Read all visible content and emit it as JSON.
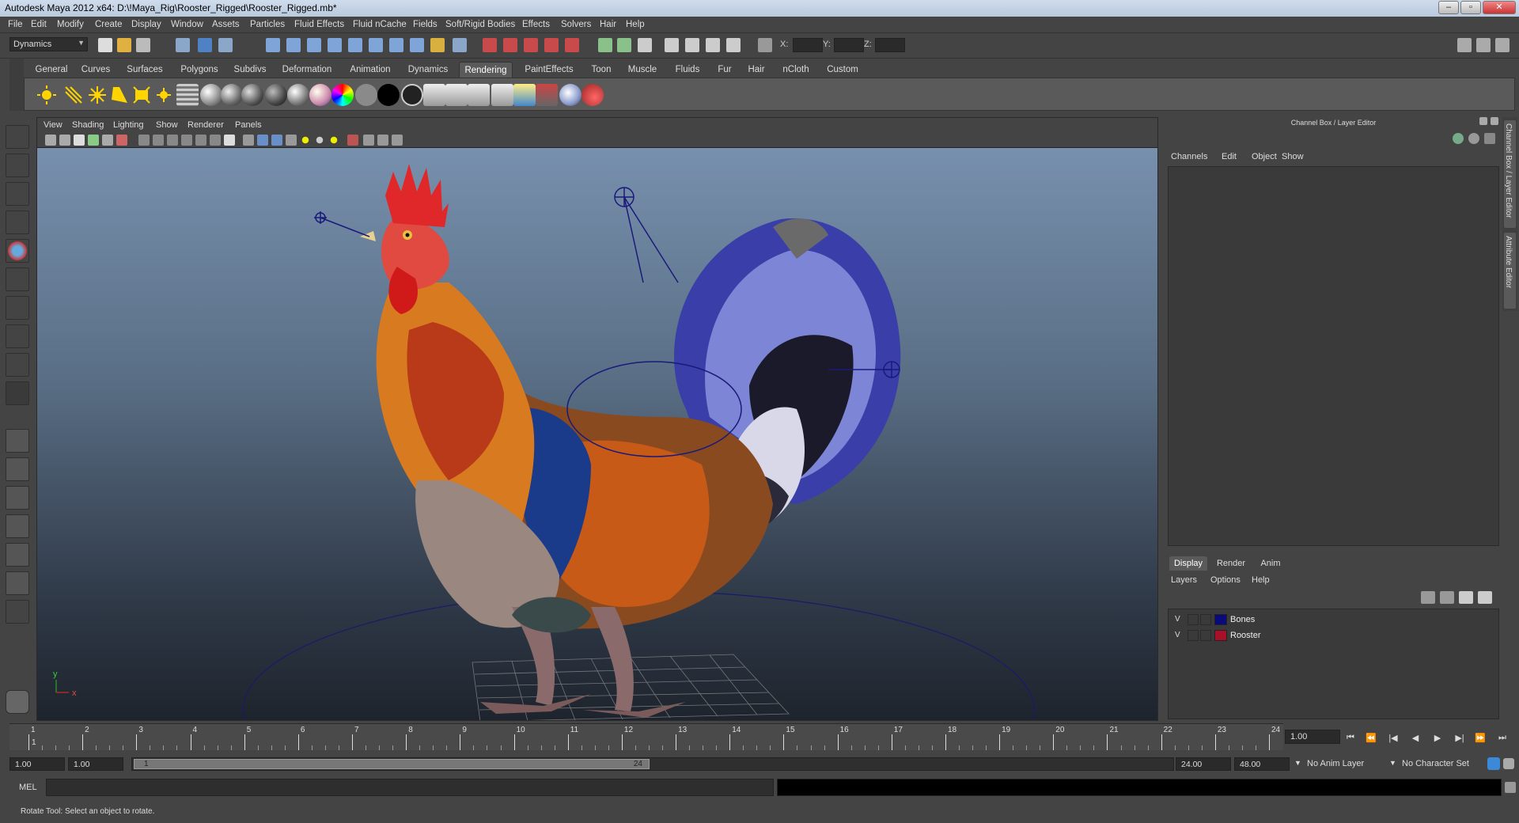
{
  "window": {
    "title": "Autodesk Maya 2012 x64: D:\\!Maya_Rig\\Rooster_Rigged\\Rooster_Rigged.mb*"
  },
  "menubar": [
    "File",
    "Edit",
    "Modify",
    "Create",
    "Display",
    "Window",
    "Assets",
    "Particles",
    "Fluid Effects",
    "Fluid nCache",
    "Fields",
    "Soft/Rigid Bodies",
    "Effects",
    "Solvers",
    "Hair",
    "Help"
  ],
  "status_line": {
    "mode": "Dynamics",
    "coord_labels": {
      "x": "X:",
      "y": "Y:",
      "z": "Z:"
    }
  },
  "shelf_tabs": [
    "General",
    "Curves",
    "Surfaces",
    "Polygons",
    "Subdivs",
    "Deformation",
    "Animation",
    "Dynamics",
    "Rendering",
    "PaintEffects",
    "Toon",
    "Muscle",
    "Fluids",
    "Fur",
    "Hair",
    "nCloth",
    "Custom"
  ],
  "active_shelf": "Rendering",
  "shelf_icons": [
    "ambient-light-icon",
    "directional-light-icon",
    "point-light-icon",
    "spot-light-icon",
    "area-light-icon",
    "volume-light-icon",
    "hypershade-icon",
    "lambert-sphere-icon",
    "blinn-sphere-icon",
    "phong-sphere-icon",
    "phonge-sphere-icon",
    "anisotropic-sphere-icon",
    "ramp-shader-icon",
    "layered-shader-icon",
    "use-background-icon",
    "black-shader-icon",
    "surface-shader-icon",
    "render-view-icon",
    "render-current-icon",
    "ipr-render-icon",
    "render-settings-icon",
    "batch-render-icon",
    "render-layer-icon",
    "mental-ray-icon",
    "paint-fx-icon"
  ],
  "viewport": {
    "menu": [
      "View",
      "Shading",
      "Lighting",
      "Show",
      "Renderer",
      "Panels"
    ],
    "axis": {
      "y": "y",
      "x": "x"
    }
  },
  "channel_box": {
    "title": "Channel Box / Layer Editor",
    "menu": [
      "Channels",
      "Edit",
      "Object",
      "Show"
    ]
  },
  "layer_editor": {
    "tabs": [
      "Display",
      "Render",
      "Anim"
    ],
    "active_tab": "Display",
    "menu": [
      "Layers",
      "Options",
      "Help"
    ],
    "layers": [
      {
        "visible": "V",
        "name": "Bones",
        "color": "#0a0a7a"
      },
      {
        "visible": "V",
        "name": "Rooster",
        "color": "#a8102a"
      }
    ]
  },
  "side_tabs": [
    "Channel Box / Layer Editor",
    "Attribute Editor"
  ],
  "time_slider": {
    "ticks": [
      "1",
      "2",
      "3",
      "4",
      "5",
      "6",
      "7",
      "8",
      "9",
      "10",
      "11",
      "12",
      "13",
      "14",
      "15",
      "16",
      "17",
      "18",
      "19",
      "20",
      "21",
      "22",
      "23",
      "24"
    ],
    "marker": "1",
    "current_frame": "1.00"
  },
  "range_slider": {
    "start_time": "1.00",
    "playback_start": "1.00",
    "range_start": "1",
    "range_end": "24",
    "playback_end": "24.00",
    "end_time": "48.00",
    "anim_layer": "No Anim Layer",
    "character_set": "No Character Set"
  },
  "command_line": {
    "language": "MEL"
  },
  "help_line": {
    "text": "Rotate Tool: Select an object to rotate."
  },
  "colors": {
    "accent": "#5a5a5a",
    "ui_bg": "#444444",
    "viewport_top": "#7790ad",
    "viewport_bottom": "#1e242d"
  }
}
